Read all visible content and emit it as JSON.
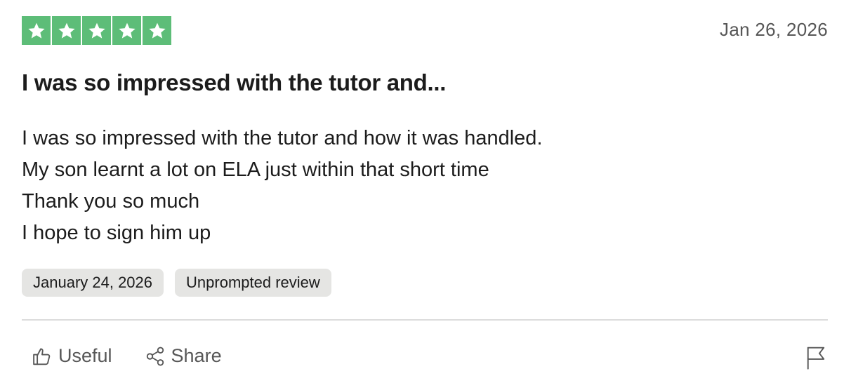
{
  "review": {
    "rating": 5,
    "rating_max": 5,
    "star_color": "#5dbd78",
    "date": "Jan 26, 2026",
    "title": "I was so impressed with the tutor and...",
    "body": [
      "I was so impressed with the tutor and how it was handled.",
      "My son learnt a lot on ELA just within that short time",
      "Thank you so much",
      "I hope to sign him up"
    ],
    "tags": {
      "experience_date": "January 24, 2026",
      "review_type": "Unprompted review"
    }
  },
  "actions": {
    "useful_label": "Useful",
    "useful_icon": "thumbs-up-icon",
    "share_label": "Share",
    "share_icon": "share-icon",
    "report_icon": "flag-icon"
  }
}
